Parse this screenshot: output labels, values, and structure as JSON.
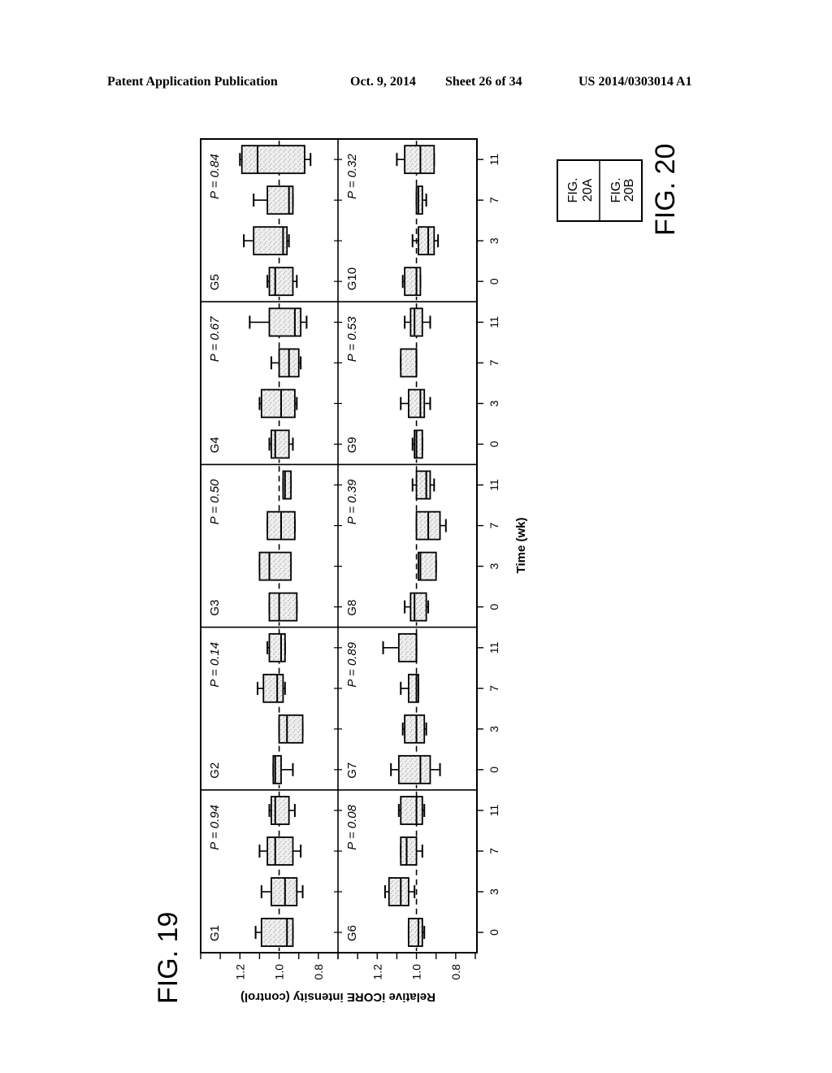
{
  "header": {
    "publication": "Patent Application Publication",
    "date": "Oct. 9, 2014",
    "sheet": "Sheet 26 of 34",
    "patent_number": "US 2014/0303014 A1"
  },
  "fig19_label": "FIG. 19",
  "fig20": {
    "label": "FIG. 20",
    "panels": [
      {
        "line1": "FIG.",
        "line2": "20A"
      },
      {
        "line1": "FIG.",
        "line2": "20B"
      }
    ]
  },
  "chart_data": {
    "type": "box",
    "title": "FIG. 19",
    "xlabel": "Time (wk)",
    "ylabel": "Relative iCORE intensity (control)",
    "categories": [
      "0",
      "3",
      "7",
      "11"
    ],
    "ylim": [
      0.7,
      1.4
    ],
    "yticks": [
      1.2,
      1.0,
      0.8
    ],
    "ytick_labels": [
      "1.2",
      "1.0",
      "0.8"
    ],
    "reference_line": 1.0,
    "orientation": "rotated 90 degrees counter-clockwise on page",
    "box_fields": [
      "whisker_high",
      "q3",
      "median",
      "q1",
      "whisker_low"
    ],
    "panels": [
      {
        "name": "G1",
        "p_label": "P = 0.94",
        "boxes": [
          [
            1.12,
            1.09,
            0.96,
            0.93,
            0.93
          ],
          [
            1.09,
            1.04,
            0.97,
            0.91,
            0.88
          ],
          [
            1.1,
            1.06,
            1.02,
            0.93,
            0.89
          ],
          [
            1.05,
            1.04,
            1.02,
            0.95,
            0.92
          ]
        ]
      },
      {
        "name": "G2",
        "p_label": "P = 0.14",
        "boxes": [
          [
            1.03,
            1.03,
            1.02,
            0.99,
            0.93
          ],
          [
            1.0,
            1.0,
            0.96,
            0.88,
            0.88
          ],
          [
            1.11,
            1.08,
            1.01,
            0.98,
            0.97
          ],
          [
            1.06,
            1.05,
            0.99,
            0.97,
            0.97
          ]
        ]
      },
      {
        "name": "G3",
        "p_label": "P = 0.50",
        "boxes": [
          [
            1.05,
            1.05,
            1.0,
            0.91,
            0.91
          ],
          [
            1.1,
            1.1,
            1.05,
            0.94,
            0.94
          ],
          [
            1.06,
            1.06,
            0.99,
            0.92,
            0.92
          ],
          [
            0.98,
            0.98,
            0.97,
            0.94,
            0.94
          ]
        ]
      },
      {
        "name": "G4",
        "p_label": "P = 0.67",
        "boxes": [
          [
            1.05,
            1.04,
            1.02,
            0.95,
            0.93
          ],
          [
            1.1,
            1.09,
            0.99,
            0.92,
            0.91
          ],
          [
            1.04,
            1.0,
            0.95,
            0.9,
            0.89
          ],
          [
            1.15,
            1.05,
            0.92,
            0.89,
            0.86
          ]
        ]
      },
      {
        "name": "G5",
        "p_label": "P = 0.84",
        "boxes": [
          [
            1.06,
            1.05,
            1.02,
            0.93,
            0.91
          ],
          [
            1.18,
            1.13,
            0.98,
            0.96,
            0.95
          ],
          [
            1.13,
            1.06,
            0.95,
            0.93,
            0.93
          ],
          [
            1.2,
            1.19,
            1.11,
            0.87,
            0.84
          ]
        ]
      },
      {
        "name": "G6",
        "p_label": "P = 0.08",
        "boxes": [
          [
            1.04,
            1.04,
            0.99,
            0.97,
            0.96
          ],
          [
            1.16,
            1.14,
            1.08,
            1.04,
            1.01
          ],
          [
            1.08,
            1.08,
            1.05,
            1.0,
            0.97
          ],
          [
            1.09,
            1.08,
            1.0,
            0.97,
            0.96
          ]
        ]
      },
      {
        "name": "G7",
        "p_label": "P = 0.89",
        "boxes": [
          [
            1.13,
            1.09,
            0.98,
            0.93,
            0.88
          ],
          [
            1.07,
            1.06,
            1.0,
            0.96,
            0.95
          ],
          [
            1.08,
            1.04,
            1.0,
            0.99,
            0.99
          ],
          [
            1.17,
            1.09,
            1.0,
            1.0,
            1.0
          ]
        ]
      },
      {
        "name": "G8",
        "p_label": "P = 0.39",
        "boxes": [
          [
            1.06,
            1.03,
            1.01,
            0.95,
            0.94
          ],
          [
            0.99,
            0.99,
            0.98,
            0.9,
            0.9
          ],
          [
            1.0,
            1.0,
            0.94,
            0.88,
            0.85
          ],
          [
            1.02,
            1.0,
            0.95,
            0.93,
            0.91
          ]
        ]
      },
      {
        "name": "G9",
        "p_label": "P = 0.53",
        "boxes": [
          [
            1.02,
            1.01,
            1.0,
            0.97,
            0.97
          ],
          [
            1.08,
            1.04,
            0.98,
            0.96,
            0.93
          ],
          [
            1.08,
            1.08,
            1.0,
            1.0,
            1.0
          ],
          [
            1.06,
            1.03,
            1.01,
            0.97,
            0.93
          ]
        ]
      },
      {
        "name": "G10",
        "p_label": "P = 0.32",
        "boxes": [
          [
            1.07,
            1.06,
            1.0,
            0.98,
            0.98
          ],
          [
            1.02,
            0.99,
            0.94,
            0.91,
            0.89
          ],
          [
            1.0,
            1.0,
            0.99,
            0.97,
            0.95
          ],
          [
            1.1,
            1.06,
            0.98,
            0.91,
            0.91
          ]
        ]
      }
    ],
    "grid": false,
    "legend": "none"
  },
  "colors": {
    "ink": "#000000",
    "box_fill": "#ececec",
    "background": "#ffffff"
  }
}
